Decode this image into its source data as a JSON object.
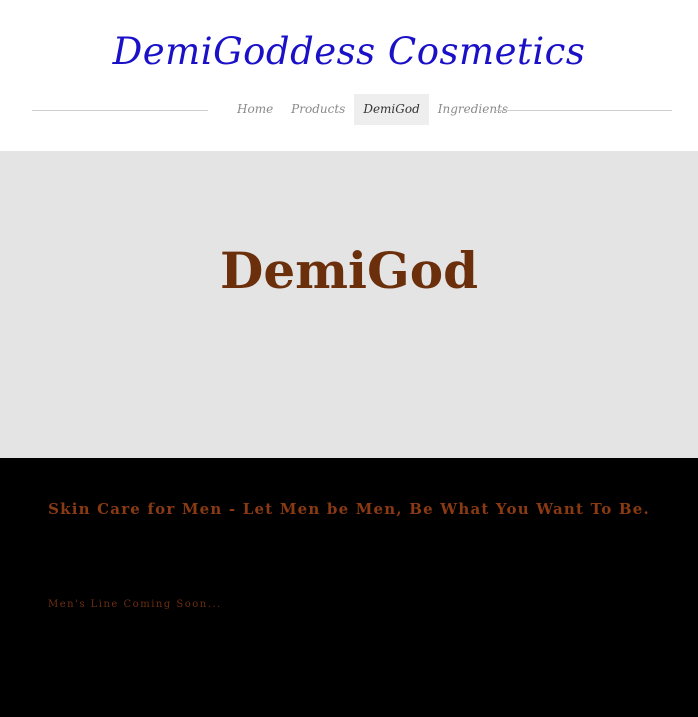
{
  "header": {
    "site_title": "DemiGoddess Cosmetics",
    "nav": [
      {
        "label": "Home",
        "active": false
      },
      {
        "label": "Products",
        "active": false
      },
      {
        "label": "DemiGod",
        "active": true
      },
      {
        "label": "Ingredients",
        "active": false
      }
    ]
  },
  "hero": {
    "title": "DemiGod"
  },
  "content": {
    "tagline": "Skin Care for Men - Let Men be Men, Be What You Want To Be.",
    "notice": "Men's Line Coming Soon..."
  },
  "colors": {
    "title_blue": "#1a10c8",
    "brown": "#6b2f0c",
    "hero_bg": "#e4e4e4",
    "dark_bg": "#000000"
  }
}
